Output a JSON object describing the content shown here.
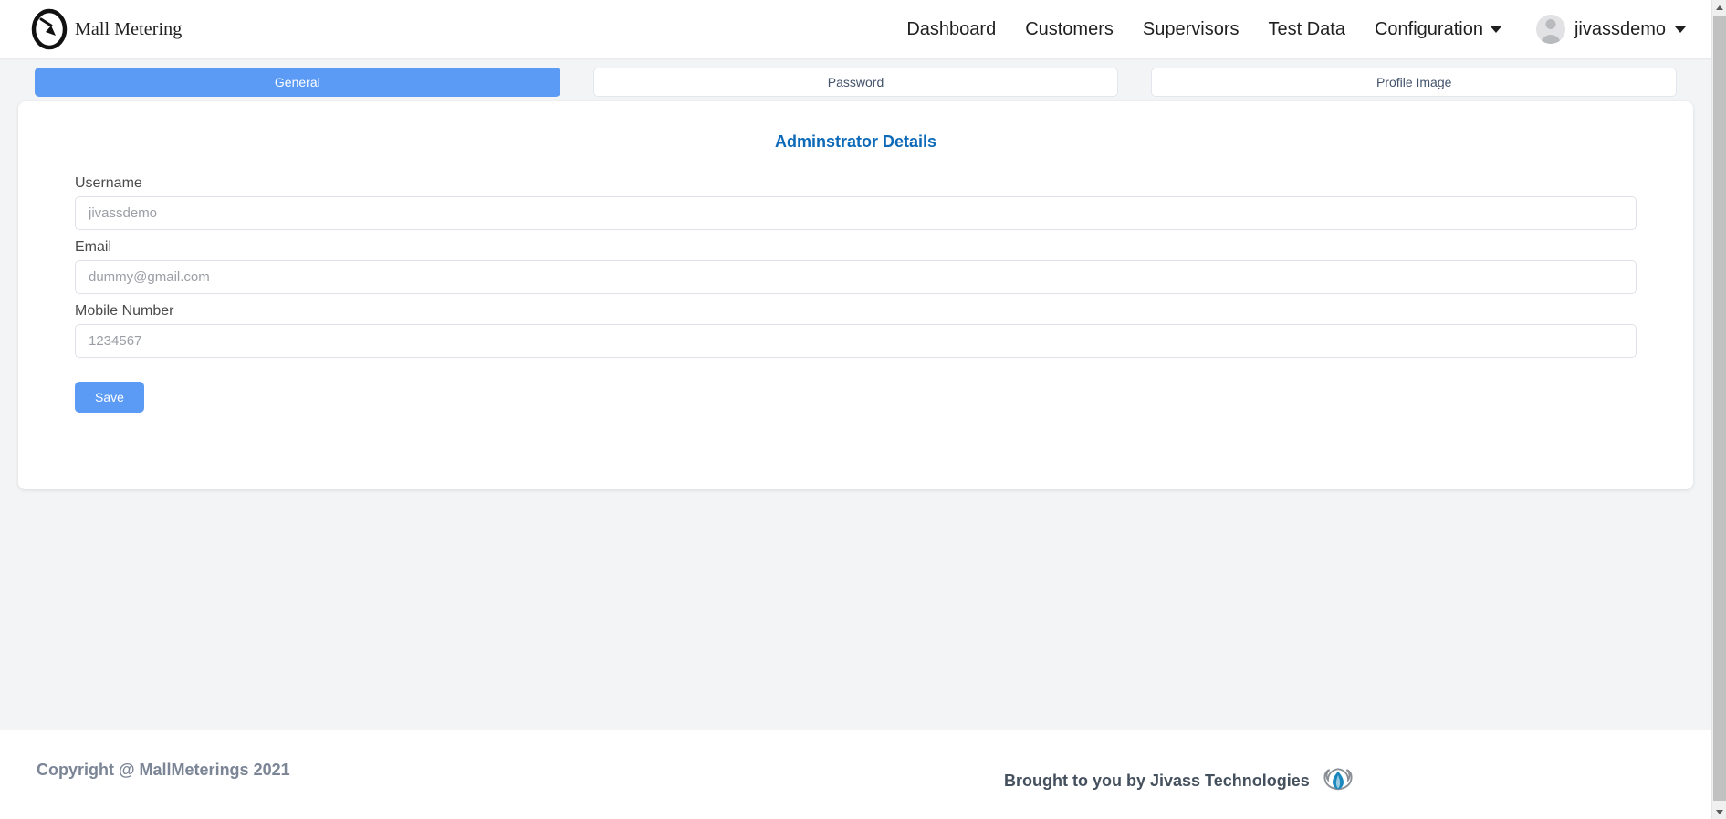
{
  "brand": {
    "name": "Mall Metering",
    "logo_icon": "meter-gauge-icon"
  },
  "navbar": {
    "links": [
      {
        "label": "Dashboard",
        "name": "nav-dashboard"
      },
      {
        "label": "Customers",
        "name": "nav-customers"
      },
      {
        "label": "Supervisors",
        "name": "nav-supervisors"
      },
      {
        "label": "Test Data",
        "name": "nav-test-data"
      }
    ],
    "dropdown": {
      "label": "Configuration",
      "caret_icon": "chevron-down-icon"
    },
    "user": {
      "name": "jivassdemo",
      "avatar_icon": "user-avatar-icon",
      "caret_icon": "chevron-down-icon"
    }
  },
  "tabs": [
    {
      "label": "General",
      "active": true
    },
    {
      "label": "Password",
      "active": false
    },
    {
      "label": "Profile Image",
      "active": false
    }
  ],
  "card": {
    "title": "Adminstrator Details",
    "fields": [
      {
        "label": "Username",
        "value": "jivassdemo",
        "placeholder": "jivassdemo"
      },
      {
        "label": "Email",
        "value": "dummy@gmail.com",
        "placeholder": "dummy@gmail.com"
      },
      {
        "label": "Mobile Number",
        "value": "1234567",
        "placeholder": "1234567"
      }
    ],
    "save_label": "Save"
  },
  "footer": {
    "copyright": "Copyright @ MallMeterings 2021",
    "credit": "Brought to you by Jivass Technologies",
    "credit_logo_icon": "jivass-flame-icon"
  },
  "colors": {
    "accent_blue": "#5b9bf6",
    "title_blue": "#0d6ab8",
    "page_background": "#f3f4f6",
    "card_background": "#ffffff",
    "footer_text": "#7b8596",
    "jivass_blue": "#1a87bd"
  }
}
